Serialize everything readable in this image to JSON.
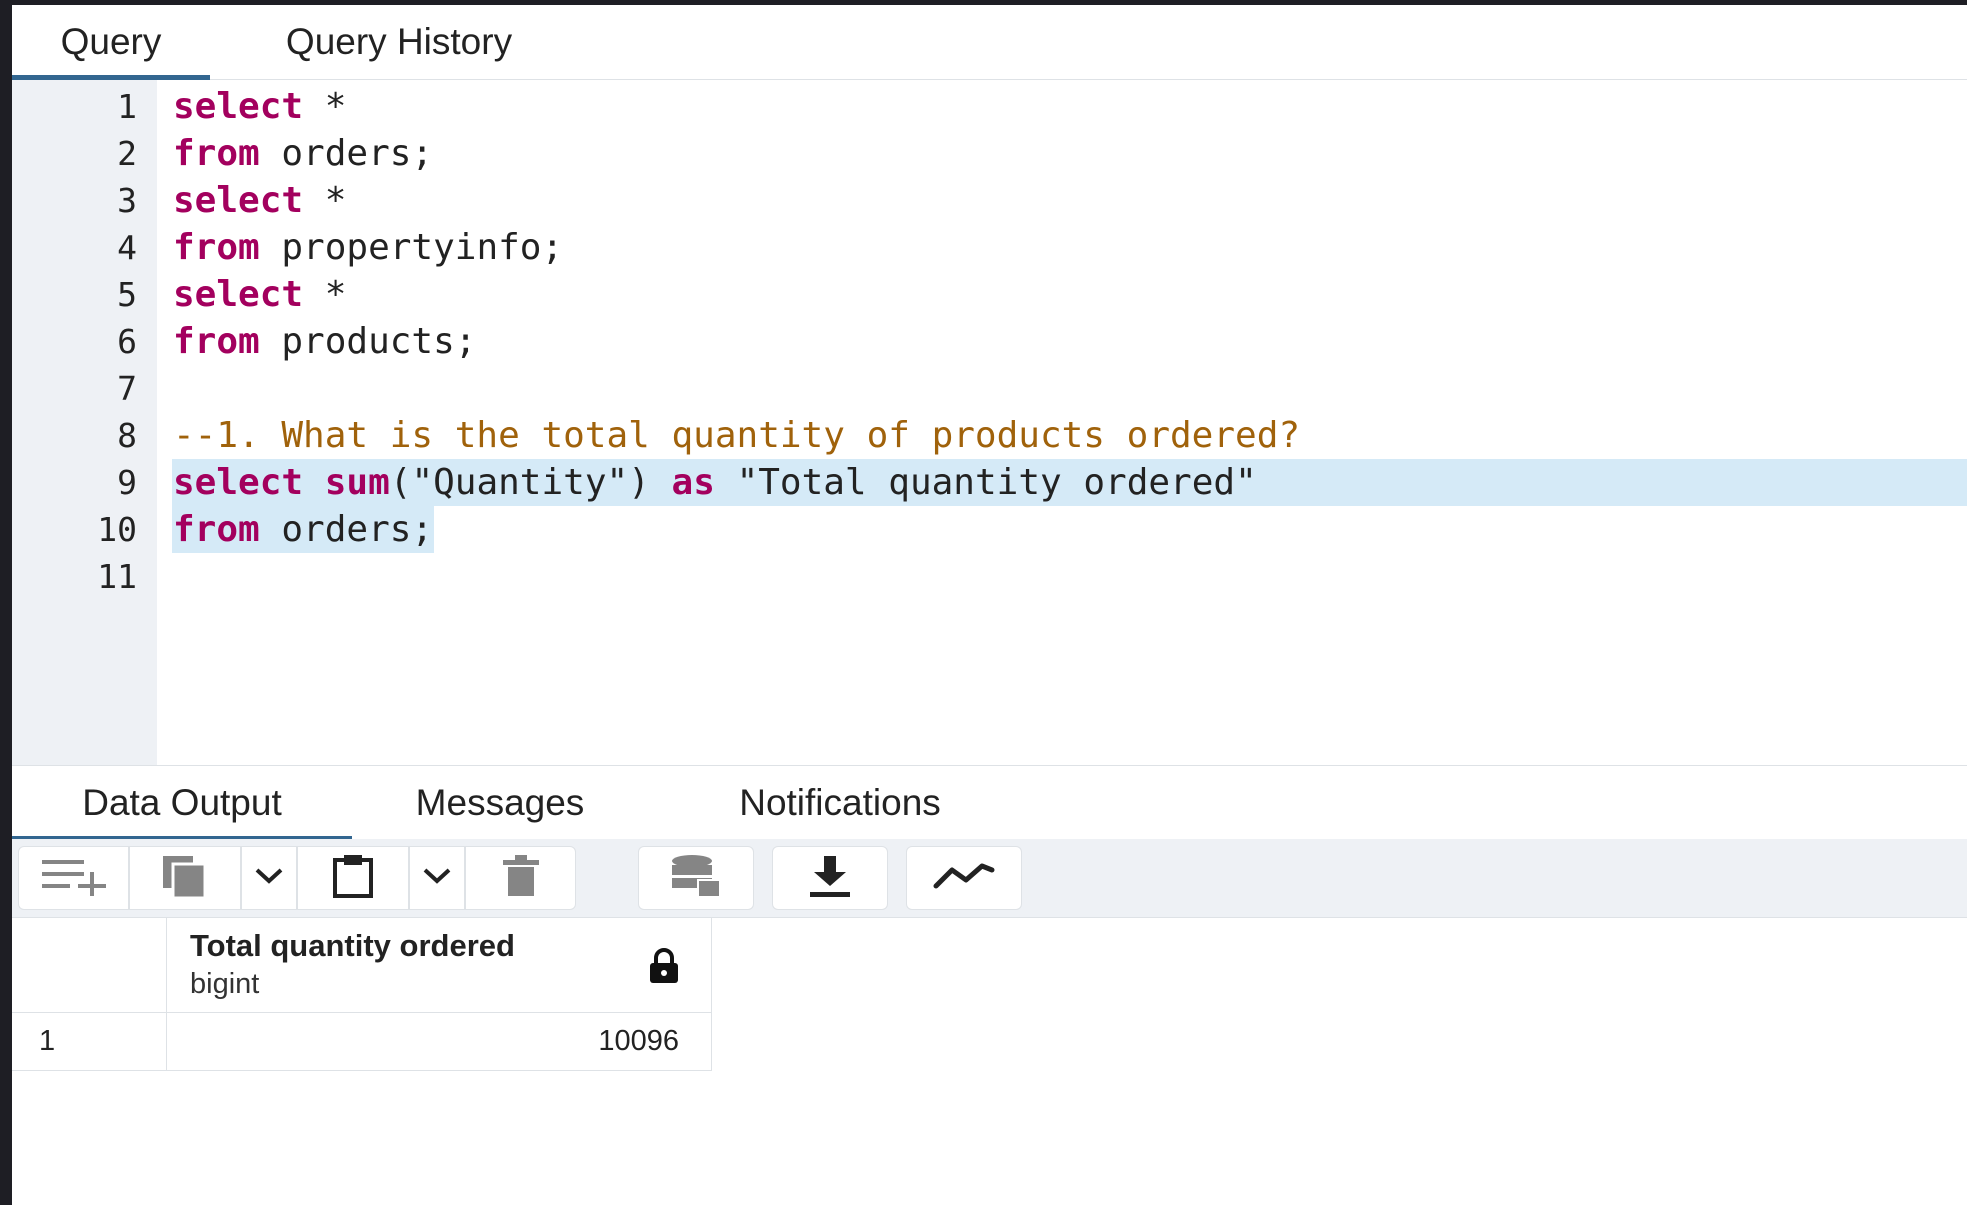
{
  "query_tabs": [
    {
      "label": "Query",
      "active": true
    },
    {
      "label": "Query History",
      "active": false
    }
  ],
  "editor": {
    "line_numbers": [
      "1",
      "2",
      "3",
      "4",
      "5",
      "6",
      "7",
      "8",
      "9",
      "10",
      "11"
    ],
    "lines": [
      {
        "tokens": [
          {
            "t": "select",
            "k": "kw"
          },
          {
            "t": " *",
            "k": "st"
          }
        ]
      },
      {
        "tokens": [
          {
            "t": "from",
            "k": "kw"
          },
          {
            "t": " orders;",
            "k": "st"
          }
        ]
      },
      {
        "tokens": [
          {
            "t": "select",
            "k": "kw"
          },
          {
            "t": " *",
            "k": "st"
          }
        ]
      },
      {
        "tokens": [
          {
            "t": "from",
            "k": "kw"
          },
          {
            "t": " propertyinfo;",
            "k": "st"
          }
        ]
      },
      {
        "tokens": [
          {
            "t": "select",
            "k": "kw"
          },
          {
            "t": " *",
            "k": "st"
          }
        ]
      },
      {
        "tokens": [
          {
            "t": "from",
            "k": "kw"
          },
          {
            "t": " products;",
            "k": "st"
          }
        ]
      },
      {
        "tokens": []
      },
      {
        "tokens": [
          {
            "t": "--1. What is the total quantity of products ordered?",
            "k": "cm"
          }
        ]
      },
      {
        "tokens": [
          {
            "t": "select",
            "k": "kw"
          },
          {
            "t": " ",
            "k": "st"
          },
          {
            "t": "sum",
            "k": "kw"
          },
          {
            "t": "(\"Quantity\") ",
            "k": "st"
          },
          {
            "t": "as",
            "k": "kw"
          },
          {
            "t": " \"Total quantity ordered\"",
            "k": "st"
          }
        ],
        "highlight": "full"
      },
      {
        "tokens": [
          {
            "t": "from",
            "k": "kw"
          },
          {
            "t": " orders;",
            "k": "st"
          }
        ],
        "highlight": "partial"
      },
      {
        "tokens": []
      }
    ]
  },
  "output_tabs": [
    {
      "label": "Data Output",
      "active": true
    },
    {
      "label": "Messages",
      "active": false
    },
    {
      "label": "Notifications",
      "active": false
    }
  ],
  "toolbar": {
    "buttons": [
      {
        "icon": "add-row-icon"
      },
      {
        "icon": "copy-icon"
      },
      {
        "icon": "chevron-down-icon"
      },
      {
        "icon": "paste-icon"
      },
      {
        "icon": "chevron-down-icon"
      },
      {
        "icon": "trash-icon"
      },
      {
        "icon": "save-data-icon"
      },
      {
        "icon": "download-icon"
      },
      {
        "icon": "graph-icon"
      }
    ]
  },
  "grid": {
    "columns": [
      {
        "name": "Total quantity ordered",
        "type": "bigint",
        "locked": true
      }
    ],
    "rows": [
      {
        "num": "1",
        "values": [
          "10096"
        ]
      }
    ]
  }
}
